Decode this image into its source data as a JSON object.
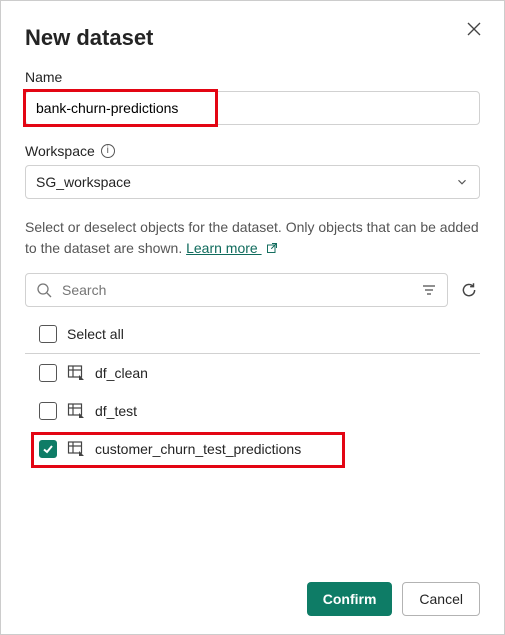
{
  "dialog": {
    "title": "New dataset"
  },
  "name": {
    "label": "Name",
    "value": "bank-churn-predictions"
  },
  "workspace": {
    "label": "Workspace",
    "value": "SG_workspace"
  },
  "helper": {
    "text_a": "Select or deselect objects for the dataset. Only objects that can be added to the dataset are shown. ",
    "learn_more": "Learn more "
  },
  "search": {
    "placeholder": "Search"
  },
  "select_all_label": "Select all",
  "items": [
    {
      "label": "df_clean",
      "checked": false
    },
    {
      "label": "df_test",
      "checked": false
    },
    {
      "label": "customer_churn_test_predictions",
      "checked": true
    }
  ],
  "footer": {
    "confirm": "Confirm",
    "cancel": "Cancel"
  }
}
